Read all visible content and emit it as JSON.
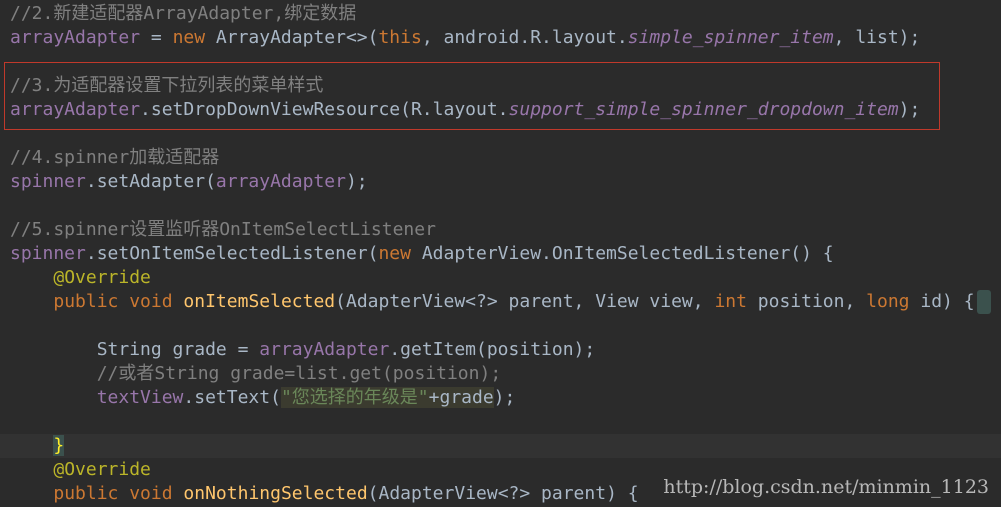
{
  "code": {
    "l1": {
      "t1": "//2.新建适配器ArrayAdapter,绑定数据"
    },
    "l2": {
      "t1": "arrayAdapter",
      "t2": " = ",
      "t3": "new",
      "t4": " ArrayAdapter<>(",
      "t5": "this",
      "t6": ", android.R.layout.",
      "t7": "simple_spinner_item",
      "t8": ", list);"
    },
    "l3": {
      "t1": "//3.为适配器设置下拉列表的菜单样式"
    },
    "l4": {
      "t1": "arrayAdapter",
      "t2": ".setDropDownViewResource(R.layout.",
      "t3": "support_simple_spinner_dropdown_item",
      "t4": ");"
    },
    "l5": {
      "t1": "//4.spinner加载适配器"
    },
    "l6": {
      "t1": "spinner",
      "t2": ".setAdapter(",
      "t3": "arrayAdapter",
      "t4": ");"
    },
    "l7": {
      "t1": "//5.spinner设置监听器OnItemSelectListener"
    },
    "l8": {
      "t1": "spinner",
      "t2": ".setOnItemSelectedListener(",
      "t3": "new",
      "t4": " AdapterView.OnItemSelectedListener() {"
    },
    "l9": {
      "t1": "@Override"
    },
    "l10": {
      "t1": "public void",
      "t2": " ",
      "t3": "onItemSelected",
      "t4": "(AdapterView<?> parent, View view, ",
      "t5": "int",
      "t6": " position, ",
      "t7": "long",
      "t8": " id) {"
    },
    "l11": {
      "t1": "String grade = ",
      "t2": "arrayAdapter",
      "t3": ".getItem(position);"
    },
    "l12": {
      "t1": "//或者String grade=list.get(position);"
    },
    "l13": {
      "t1": "textView",
      "t2": ".setText(",
      "t3": "\"您选择的年级是\"",
      "t4": "+grade",
      "t5": ");"
    },
    "l14": {
      "t1": "}"
    },
    "l15": {
      "t1": "@Override"
    },
    "l16": {
      "t1": "public void",
      "t2": " ",
      "t3": "onNothingSelected",
      "t4": "(AdapterView<?> parent) {"
    }
  },
  "watermark": "http://blog.csdn.net/minmin_1123",
  "colors": {
    "background": "#2b2b2b",
    "comment": "#808080",
    "keyword": "#cc7832",
    "field": "#9876aa",
    "method": "#ffc66d",
    "annotation": "#bbb529",
    "string": "#6a8759",
    "highlight_box": "#c0392b"
  }
}
